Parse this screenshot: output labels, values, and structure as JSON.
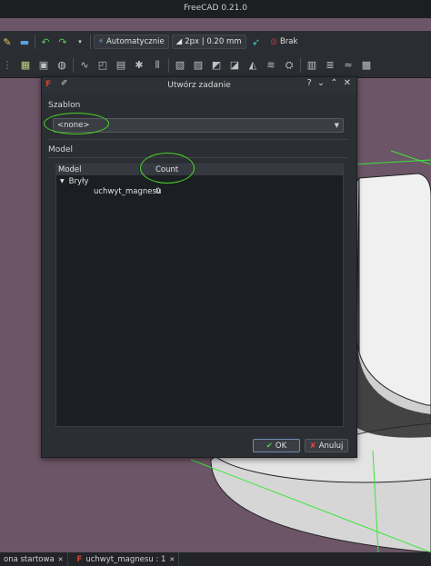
{
  "window": {
    "title": "FreeCAD 0.21.0"
  },
  "toolbar": {
    "draw_style_label": "Automatycznie",
    "line_width_label": "2px | 0.20 mm",
    "selection_label": "Brak"
  },
  "dialog": {
    "title": "Utwórz zadanie",
    "template_label": "Szablon",
    "template_value": "<none>",
    "model_label": "Model",
    "columns": {
      "model": "Model",
      "count": "Count"
    },
    "tree": {
      "group_label": "Bryły",
      "item_label": "uchwyt_magnesu",
      "item_count": "0"
    },
    "ok_label": "OK",
    "cancel_label": "Anuluj"
  },
  "statusbar": {
    "tab1": "ona startowa",
    "tab2": "uchwyt_magnesu : 1"
  },
  "colors": {
    "highlight": "#4ad92a",
    "accent": "#d8432f"
  }
}
